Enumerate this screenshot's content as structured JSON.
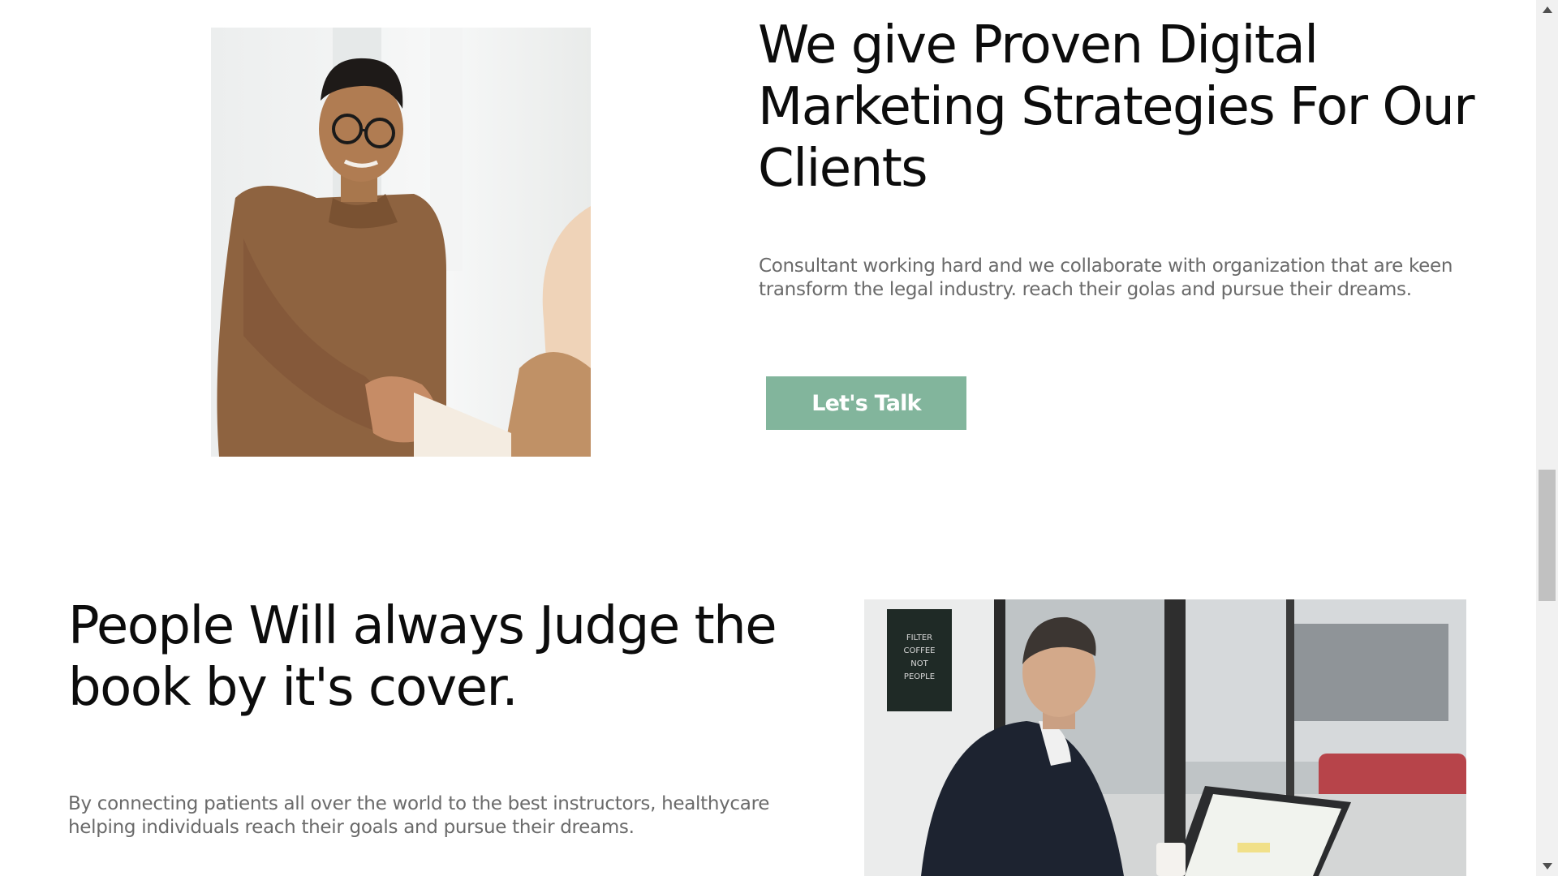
{
  "section_one": {
    "heading": "We give Proven Digital Marketing Strategies For Our Clients",
    "description": "Consultant working hard and we collaborate with organization that are keen transform the legal industry. reach their golas and pursue their dreams.",
    "cta_label": "Let's Talk",
    "accent_color": "#82b59c"
  },
  "section_two": {
    "heading": "People Will always Judge the book by it's cover.",
    "description": "By connecting patients all over the world to the best instructors, healthycare helping individuals reach their goals and pursue their dreams."
  },
  "scrollbar": {
    "up_icon": "triangle-up-icon",
    "down_icon": "triangle-down-icon"
  }
}
